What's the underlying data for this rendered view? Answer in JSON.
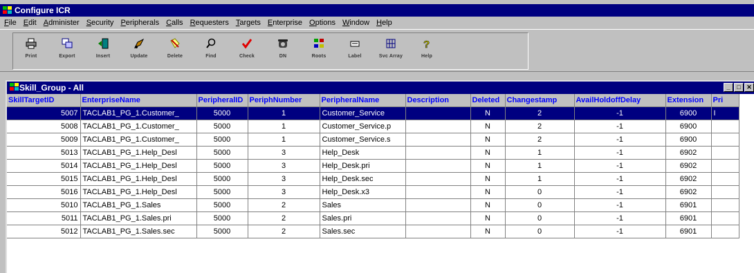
{
  "window": {
    "title": "Configure ICR"
  },
  "menu": [
    "File",
    "Edit",
    "Administer",
    "Security",
    "Peripherals",
    "Calls",
    "Requesters",
    "Targets",
    "Enterprise",
    "Options",
    "Window",
    "Help"
  ],
  "toolbar": [
    {
      "label": "Print",
      "icon": "printer-icon"
    },
    {
      "label": "Export",
      "icon": "export-icon"
    },
    {
      "label": "Insert",
      "icon": "insert-icon"
    },
    {
      "label": "Update",
      "icon": "update-icon"
    },
    {
      "label": "Delete",
      "icon": "delete-icon"
    },
    {
      "label": "Find",
      "icon": "find-icon"
    },
    {
      "label": "Check",
      "icon": "check-icon"
    },
    {
      "label": "DN",
      "icon": "phone-icon"
    },
    {
      "label": "Roots",
      "icon": "roots-icon"
    },
    {
      "label": "Label",
      "icon": "label-icon"
    },
    {
      "label": "Svc Array",
      "icon": "service-array-icon"
    },
    {
      "label": "Help",
      "icon": "help-icon"
    }
  ],
  "child_window": {
    "title": "Skill_Group - All",
    "controls": [
      "minimize",
      "maximize",
      "close"
    ]
  },
  "grid": {
    "columns": [
      "SkillTargetID",
      "EnterpriseName",
      "PeripheralID",
      "PeriphNumber",
      "PeripheralName",
      "Description",
      "Deleted",
      "Changestamp",
      "AvailHoldoffDelay",
      "Extension",
      "Pri"
    ],
    "selected_row": 0,
    "rows": [
      [
        "5007",
        "TACLAB1_PG_1.Customer_",
        "5000",
        "1",
        "Customer_Service",
        "",
        "N",
        "2",
        "-1",
        "6900",
        "I"
      ],
      [
        "5008",
        "TACLAB1_PG_1.Customer_",
        "5000",
        "1",
        "Customer_Service.p",
        "",
        "N",
        "2",
        "-1",
        "6900",
        ""
      ],
      [
        "5009",
        "TACLAB1_PG_1.Customer_",
        "5000",
        "1",
        "Customer_Service.s",
        "",
        "N",
        "2",
        "-1",
        "6900",
        ""
      ],
      [
        "5013",
        "TACLAB1_PG_1.Help_Desl",
        "5000",
        "3",
        "Help_Desk",
        "",
        "N",
        "1",
        "-1",
        "6902",
        ""
      ],
      [
        "5014",
        "TACLAB1_PG_1.Help_Desl",
        "5000",
        "3",
        "Help_Desk.pri",
        "",
        "N",
        "1",
        "-1",
        "6902",
        ""
      ],
      [
        "5015",
        "TACLAB1_PG_1.Help_Desl",
        "5000",
        "3",
        "Help_Desk.sec",
        "",
        "N",
        "1",
        "-1",
        "6902",
        ""
      ],
      [
        "5016",
        "TACLAB1_PG_1.Help_Desl",
        "5000",
        "3",
        "Help_Desk.x3",
        "",
        "N",
        "0",
        "-1",
        "6902",
        ""
      ],
      [
        "5010",
        "TACLAB1_PG_1.Sales",
        "5000",
        "2",
        "Sales",
        "",
        "N",
        "0",
        "-1",
        "6901",
        ""
      ],
      [
        "5011",
        "TACLAB1_PG_1.Sales.pri",
        "5000",
        "2",
        "Sales.pri",
        "",
        "N",
        "0",
        "-1",
        "6901",
        ""
      ],
      [
        "5012",
        "TACLAB1_PG_1.Sales.sec",
        "5000",
        "2",
        "Sales.sec",
        "",
        "N",
        "0",
        "-1",
        "6901",
        ""
      ]
    ]
  },
  "colors": {
    "titlebar": "#000080",
    "face": "#c0c0c0",
    "header_text": "#0000ff",
    "selection": "#000080"
  }
}
